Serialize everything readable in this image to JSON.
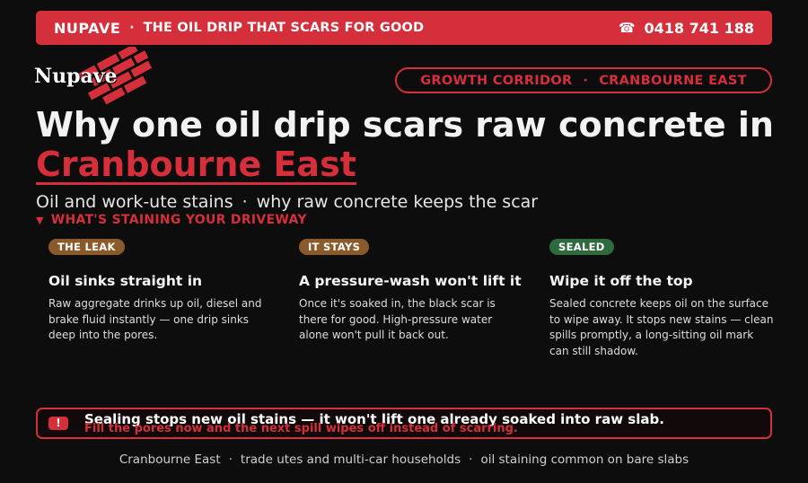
{
  "topbar": {
    "brand": "NUPAVE",
    "separator": "·",
    "tagline": "THE OIL DRIP THAT SCARS FOR GOOD",
    "phone_icon": "☎",
    "phone": "0418 741 188"
  },
  "logo": {
    "text": "Nupave",
    "icon": "brick-logo"
  },
  "pill": {
    "left": "GROWTH CORRIDOR",
    "separator": "·",
    "right": "CRANBOURNE EAST"
  },
  "headline": {
    "line1": "Why one oil drip scars raw concrete in",
    "accent": "Cranbourne East"
  },
  "subhead": {
    "left": "Oil and work-ute stains",
    "separator": "·",
    "right": "why raw concrete keeps the scar"
  },
  "section": {
    "caret": "▼",
    "label": "WHAT'S STAINING YOUR DRIVEWAY"
  },
  "cards": [
    {
      "badge": "THE LEAK",
      "title": "Oil sinks straight in",
      "body": "Raw aggregate drinks up oil, diesel and brake fluid instantly — one drip sinks deep into the pores."
    },
    {
      "badge": "IT STAYS",
      "title": "A pressure-wash won't lift it",
      "body": "Once it's soaked in, the black scar is there for good. High-pressure water alone won't pull it back out."
    },
    {
      "badge": "SEALED",
      "title": "Wipe it off the top",
      "body": "Sealed concrete keeps oil on the surface to wipe away. It stops new stains — clean spills promptly, a long-sitting oil mark can still shadow."
    }
  ],
  "alert": {
    "icon": "!",
    "main": "Sealing stops new oil stains — it won't lift one already soaked into raw slab.",
    "sub": "Fill the pores now and the next spill wipes off instead of scarring."
  },
  "footer": {
    "item1": "Cranbourne East",
    "sep": "·",
    "item2": "trade utes and multi-car households",
    "item3": "oil staining common on bare slabs"
  },
  "colors": {
    "accent": "#d42f3a",
    "background": "#0d0d0d",
    "badge_brown": "#8a5a2a",
    "badge_green": "#2f6a3d"
  }
}
